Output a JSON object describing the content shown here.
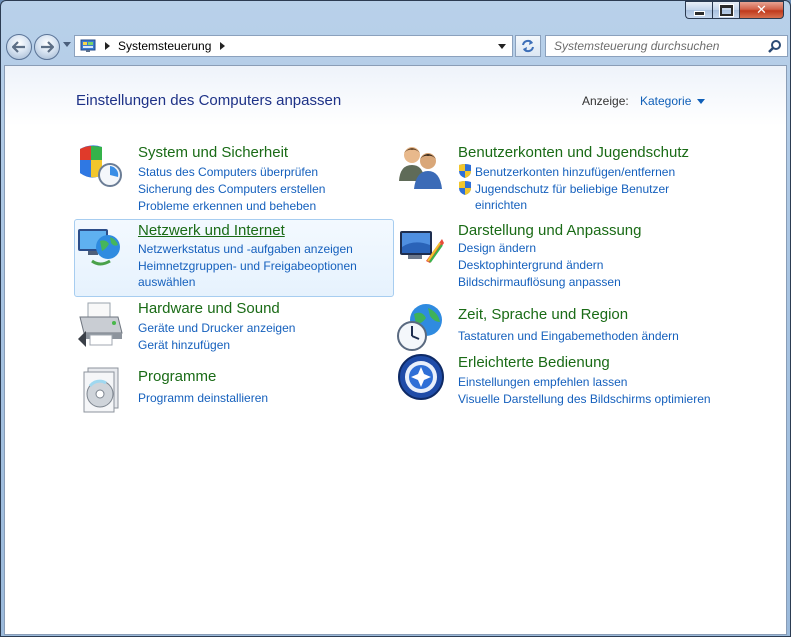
{
  "window": {
    "close_glyph": "✕"
  },
  "nav": {
    "breadcrumb": [
      "Systemsteuerung"
    ],
    "search_placeholder": "Systemsteuerung durchsuchen"
  },
  "header": {
    "title": "Einstellungen des Computers anpassen",
    "view_label": "Anzeige:",
    "view_value": "Kategorie"
  },
  "categories": {
    "system": {
      "title": "System und Sicherheit",
      "links": [
        "Status des Computers überprüfen",
        "Sicherung des Computers erstellen",
        "Probleme erkennen und beheben"
      ]
    },
    "network": {
      "title": "Netzwerk und Internet",
      "links": [
        "Netzwerkstatus und -aufgaben anzeigen",
        "Heimnetzgruppen- und Freigabeoptionen",
        "auswählen"
      ]
    },
    "hardware": {
      "title": "Hardware und Sound",
      "links": [
        "Geräte und Drucker anzeigen",
        "Gerät hinzufügen"
      ]
    },
    "programs": {
      "title": "Programme",
      "links": [
        "Programm deinstallieren"
      ]
    },
    "accounts": {
      "title": "Benutzerkonten und Jugendschutz",
      "links": [
        "Benutzerkonten hinzufügen/entfernen",
        "Jugendschutz für beliebige Benutzer",
        "einrichten"
      ]
    },
    "appearance": {
      "title": "Darstellung und Anpassung",
      "links": [
        "Design ändern",
        "Desktophintergrund ändern",
        "Bildschirmauflösung anpassen"
      ]
    },
    "clock": {
      "title": "Zeit, Sprache und Region",
      "links": [
        "Tastaturen und Eingabemethoden ändern"
      ]
    },
    "ease": {
      "title": "Erleichterte Bedienung",
      "links": [
        "Einstellungen empfehlen lassen",
        "Visuelle Darstellung des Bildschirms optimieren"
      ]
    }
  }
}
